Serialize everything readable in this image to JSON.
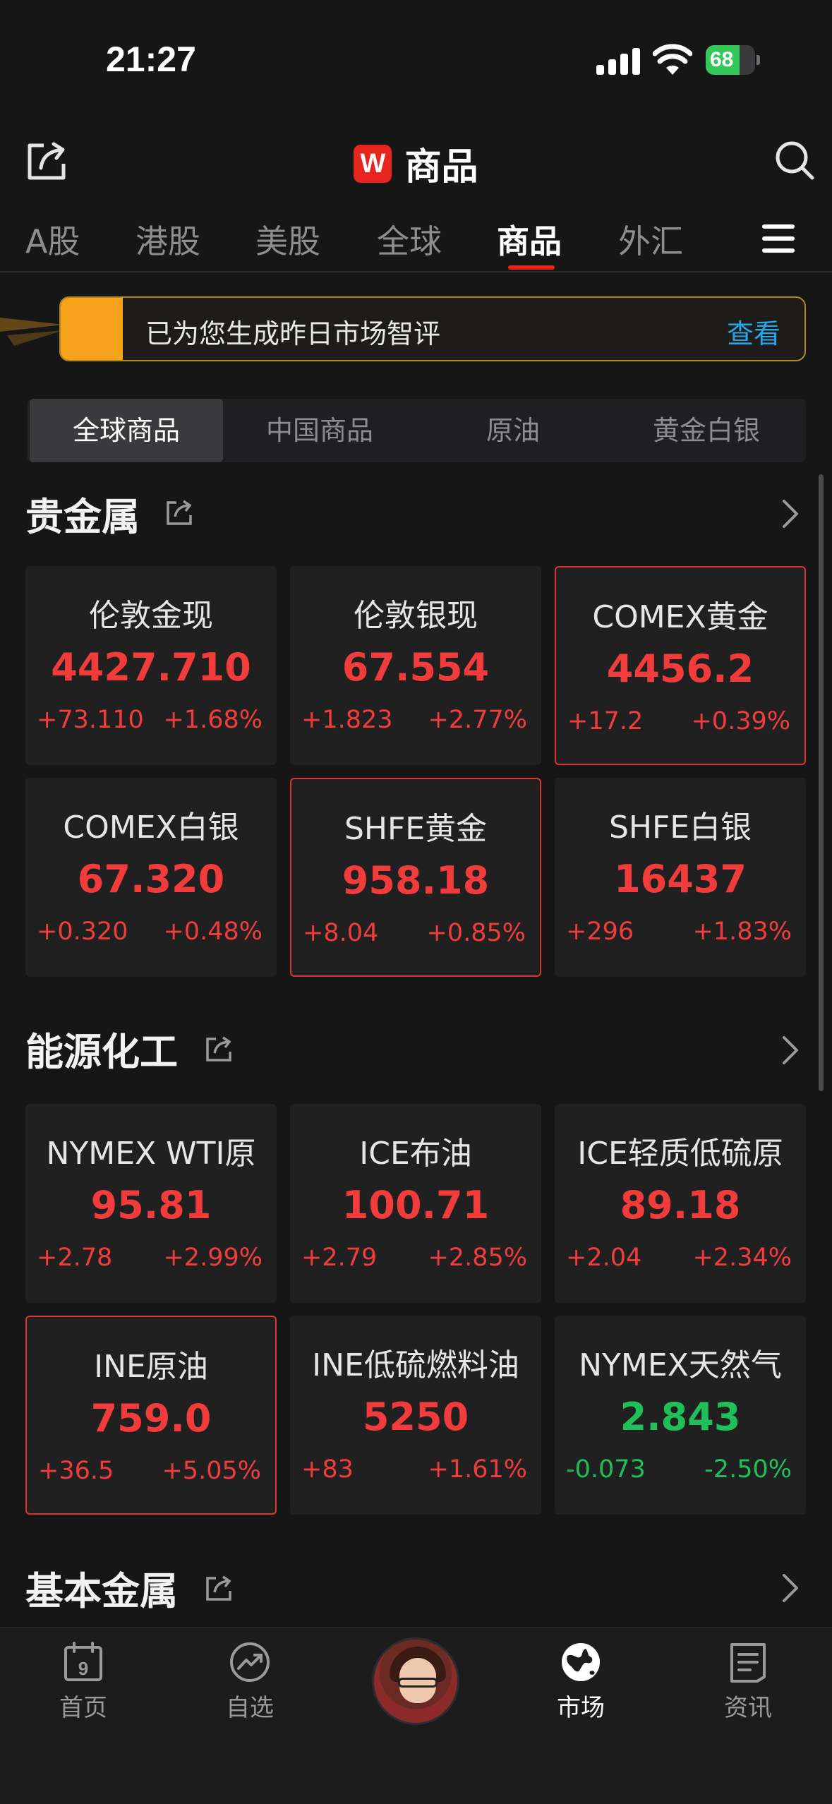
{
  "status_bar": {
    "time": "21:27",
    "battery": "68",
    "battery_level": 0.68
  },
  "header": {
    "logo_letter": "W",
    "title": "商品",
    "share_icon": "share-icon",
    "search_icon": "search-icon"
  },
  "tabs": [
    {
      "label": "A股",
      "active": false
    },
    {
      "label": "港股",
      "active": false
    },
    {
      "label": "美股",
      "active": false
    },
    {
      "label": "全球",
      "active": false
    },
    {
      "label": "商品",
      "active": true
    },
    {
      "label": "外汇",
      "active": false
    }
  ],
  "banner": {
    "text": "已为您生成昨日市场智评",
    "link": "查看"
  },
  "segments": [
    {
      "label": "全球商品",
      "active": true
    },
    {
      "label": "中国商品",
      "active": false
    },
    {
      "label": "原油",
      "active": false
    },
    {
      "label": "黄金白银",
      "active": false
    }
  ],
  "sections": [
    {
      "title": "贵金属",
      "cards": [
        {
          "name": "伦敦金现",
          "price": "4427.710",
          "change": "+73.110",
          "pct": "+1.68%",
          "dir": "up",
          "highlight": false
        },
        {
          "name": "伦敦银现",
          "price": "67.554",
          "change": "+1.823",
          "pct": "+2.77%",
          "dir": "up",
          "highlight": false
        },
        {
          "name": "COMEX黄金",
          "price": "4456.2",
          "change": "+17.2",
          "pct": "+0.39%",
          "dir": "up",
          "highlight": true
        },
        {
          "name": "COMEX白银",
          "price": "67.320",
          "change": "+0.320",
          "pct": "+0.48%",
          "dir": "up",
          "highlight": false
        },
        {
          "name": "SHFE黄金",
          "price": "958.18",
          "change": "+8.04",
          "pct": "+0.85%",
          "dir": "up",
          "highlight": true
        },
        {
          "name": "SHFE白银",
          "price": "16437",
          "change": "+296",
          "pct": "+1.83%",
          "dir": "up",
          "highlight": false
        }
      ]
    },
    {
      "title": "能源化工",
      "cards": [
        {
          "name": "NYMEX WTI原",
          "price": "95.81",
          "change": "+2.78",
          "pct": "+2.99%",
          "dir": "up",
          "highlight": false
        },
        {
          "name": "ICE布油",
          "price": "100.71",
          "change": "+2.79",
          "pct": "+2.85%",
          "dir": "up",
          "highlight": false
        },
        {
          "name": "ICE轻质低硫原",
          "price": "89.18",
          "change": "+2.04",
          "pct": "+2.34%",
          "dir": "up",
          "highlight": false
        },
        {
          "name": "INE原油",
          "price": "759.0",
          "change": "+36.5",
          "pct": "+5.05%",
          "dir": "up",
          "highlight": true
        },
        {
          "name": "INE低硫燃料油",
          "price": "5250",
          "change": "+83",
          "pct": "+1.61%",
          "dir": "up",
          "highlight": false
        },
        {
          "name": "NYMEX天然气",
          "price": "2.843",
          "change": "-0.073",
          "pct": "-2.50%",
          "dir": "down",
          "highlight": false
        }
      ]
    },
    {
      "title": "基本金属",
      "cards": []
    }
  ],
  "bottom_nav": [
    {
      "label": "首页",
      "icon": "calendar-icon",
      "calendar_day": "9",
      "active": false
    },
    {
      "label": "自选",
      "icon": "trend-icon",
      "active": false
    },
    {
      "label": "",
      "icon": "avatar",
      "active": false
    },
    {
      "label": "市场",
      "icon": "globe-icon",
      "active": true
    },
    {
      "label": "资讯",
      "icon": "news-icon",
      "active": false
    }
  ],
  "colors": {
    "up": "#f23c3c",
    "down": "#1fc05a",
    "accent": "#e8251c",
    "link": "#23a8ea",
    "banner_accent": "#f6a21a"
  }
}
